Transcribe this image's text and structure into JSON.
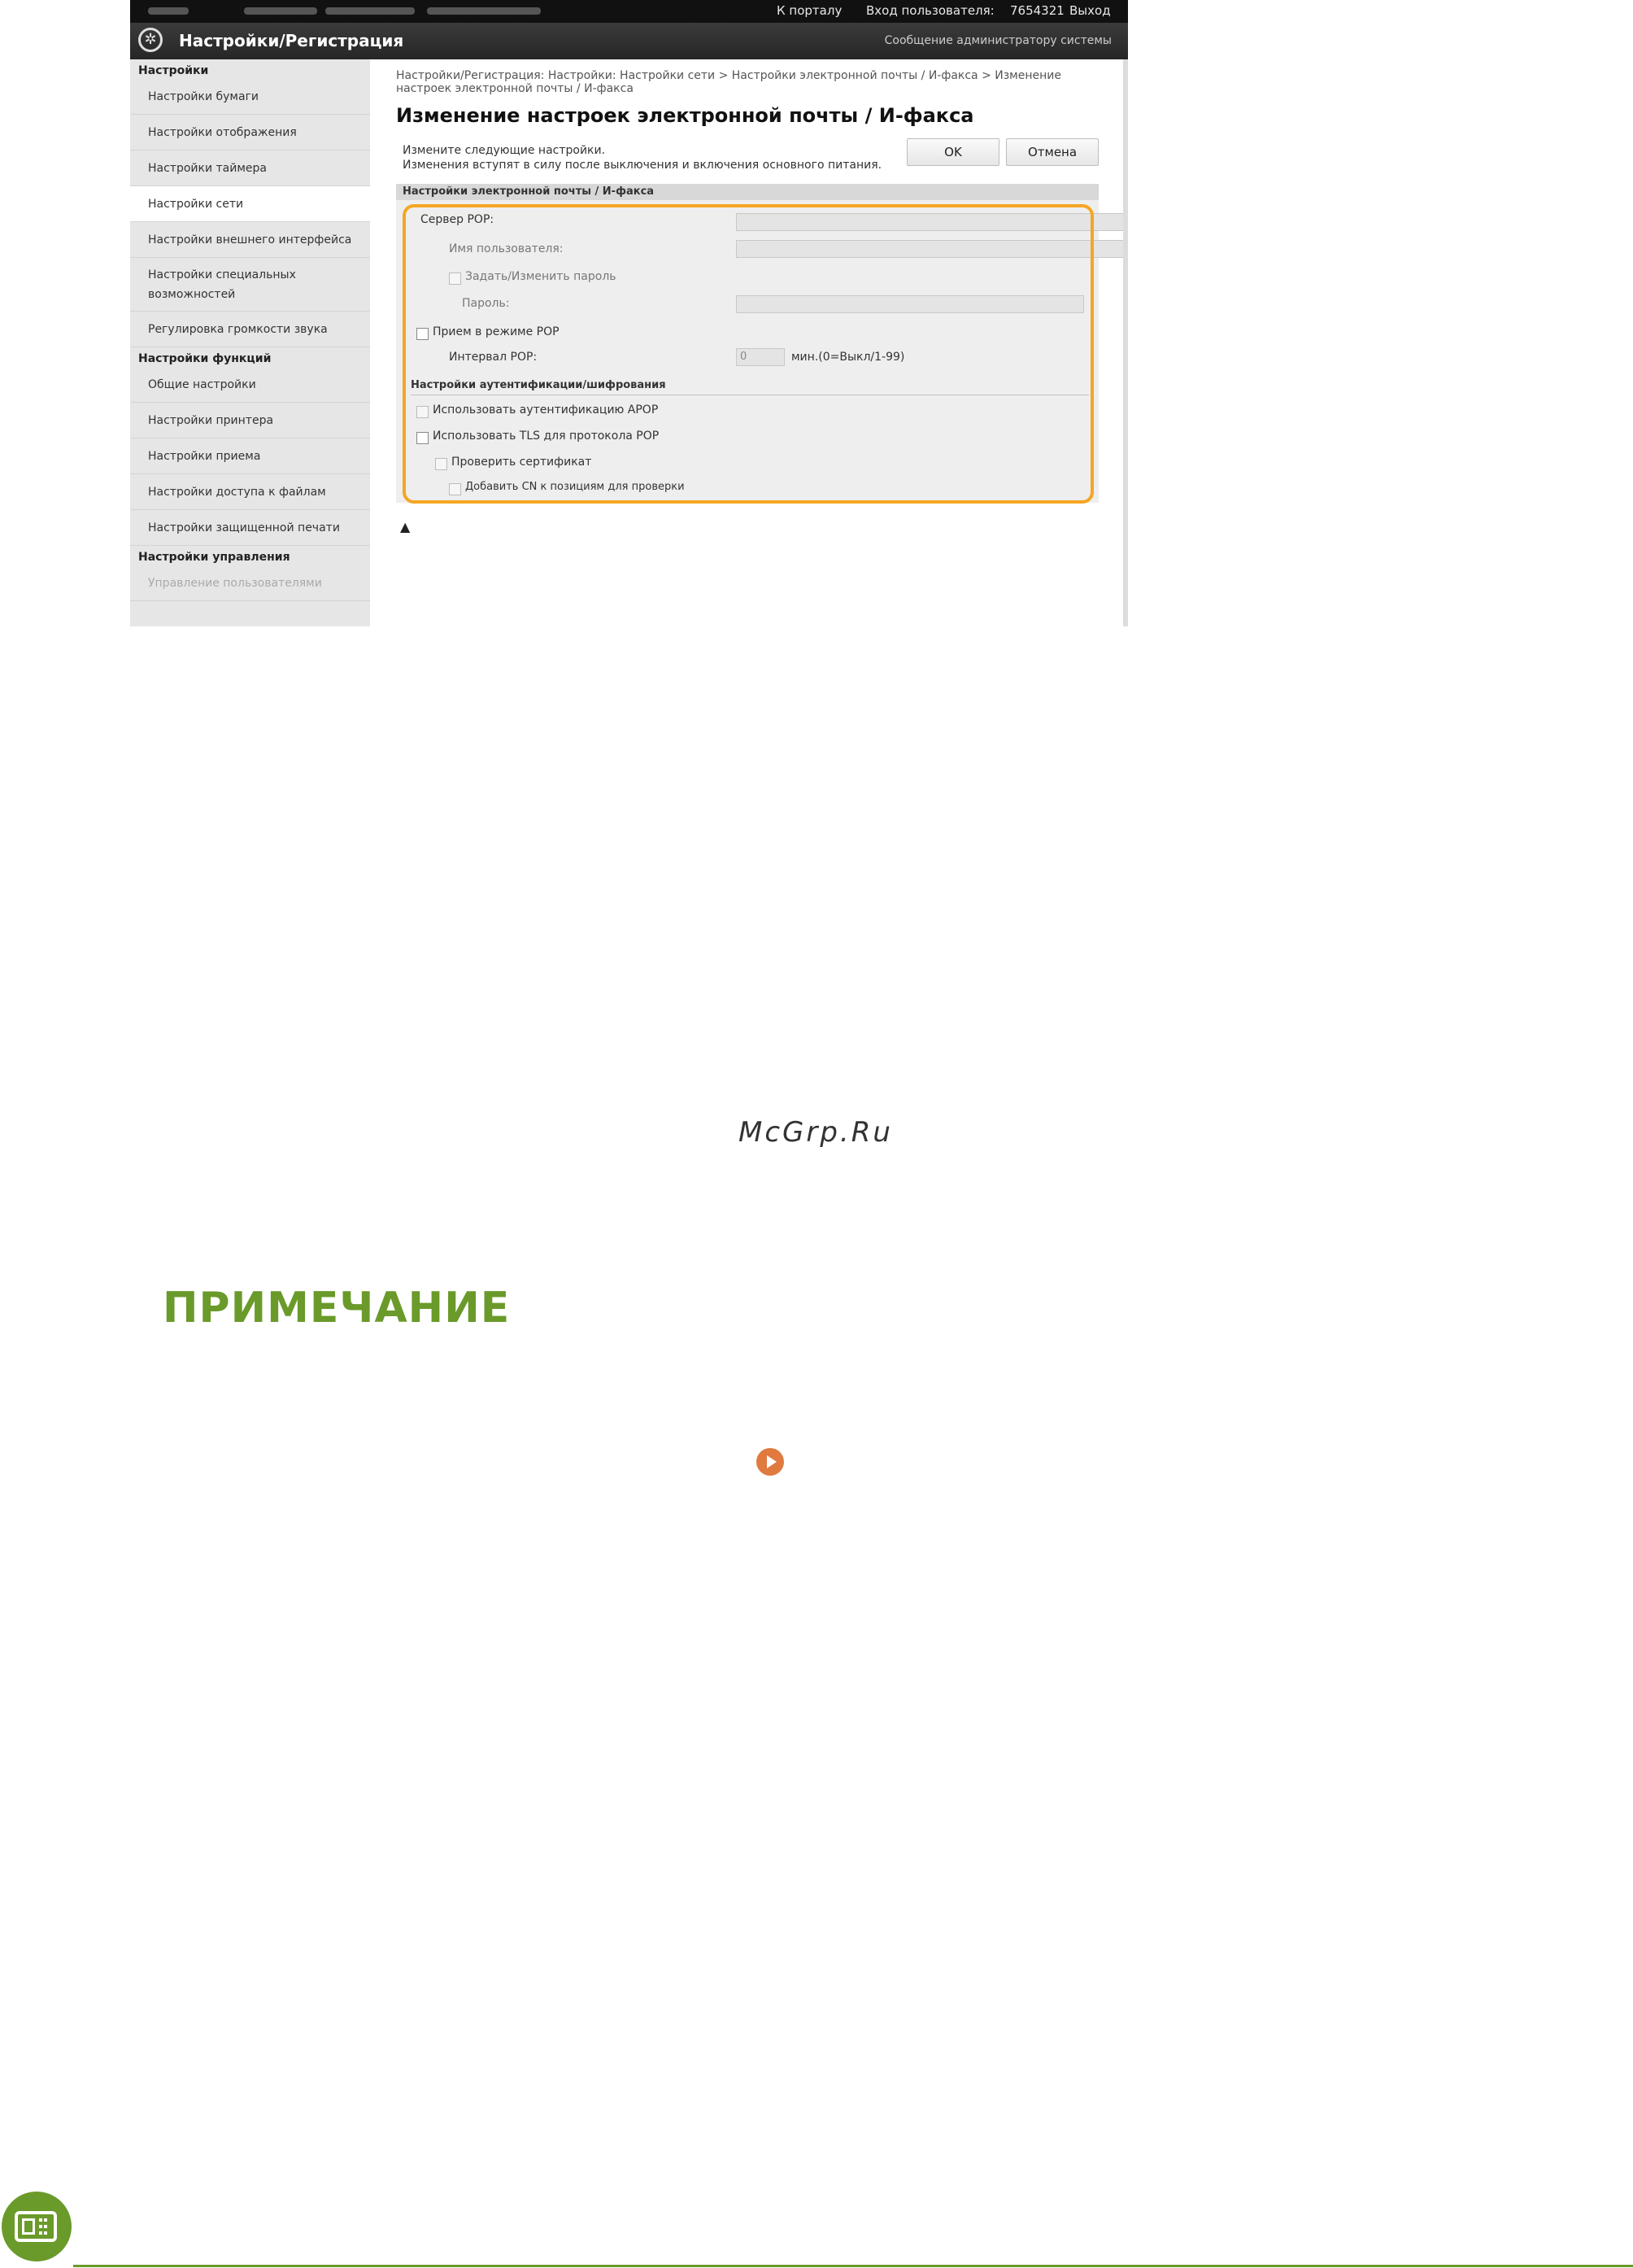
{
  "topbar": {
    "portal_link": "К порталу",
    "login_label": "Вход пользователя:",
    "user_id": "7654321",
    "logout": "Выход"
  },
  "header": {
    "title": "Настройки/Регистрация",
    "admin_message": "Сообщение администратору системы"
  },
  "sidebar": {
    "section_settings": "Настройки",
    "items": [
      "Настройки бумаги",
      "Настройки отображения",
      "Настройки таймера",
      "Настройки сети",
      "Настройки внешнего интерфейса",
      "Настройки специальных возможностей",
      "Регулировка громкости звука"
    ],
    "section_functions": "Настройки функций",
    "function_items": [
      "Общие настройки",
      "Настройки принтера",
      "Настройки приема",
      "Настройки доступа к файлам",
      "Настройки защищенной печати"
    ],
    "section_management": "Настройки управления",
    "management_items": [
      "Управление пользователями"
    ]
  },
  "main": {
    "breadcrumb": "Настройки/Регистрация: Настройки: Настройки сети > Настройки электронной почты / И-факса > Изменение настроек электронной почты / И-факса",
    "page_title": "Изменение настроек электронной почты / И-факса",
    "instruction_line1": "Измените следующие настройки.",
    "instruction_line2": "Изменения вступят в силу после выключения и включения основного питания.",
    "ok_label": "OK",
    "cancel_label": "Отмена",
    "section_title": "Настройки электронной почты / И-факса",
    "pop_server_label": "Сервер POP:",
    "username_label": "Имя пользователя:",
    "set_password_label": "Задать/Изменить пароль",
    "password_label": "Пароль:",
    "pop_receive_label": "Прием в режиме POP",
    "pop_interval_label": "Интервал POP:",
    "pop_interval_value": "0",
    "pop_interval_unit": "мин.(0=Выкл/1-99)",
    "auth_section_title": "Настройки аутентификации/шифрования",
    "apop_label": "Использовать аутентификацию APOP",
    "tls_label": "Использовать TLS для протокола POP",
    "verify_cert_label": "Проверить сертификат",
    "add_cn_label": "Добавить CN к позициям для проверки"
  },
  "document": {
    "watermark": "McGrp.Ru",
    "note_heading": "ПРИМЕЧАНИЕ"
  },
  "colors": {
    "accent_green": "#6a9a2a",
    "highlight_orange": "#f5a623",
    "link_orange": "#e07a3f"
  }
}
